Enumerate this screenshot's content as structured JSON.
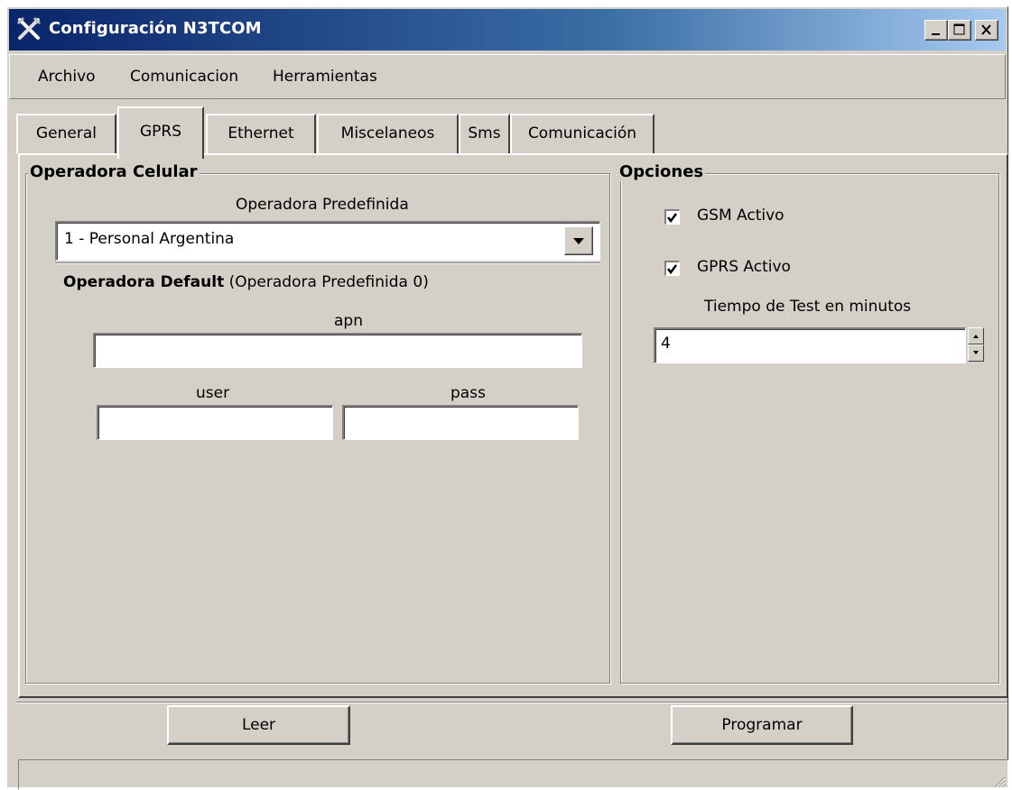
{
  "window": {
    "title": "Configuración N3TCOM",
    "icon": "tools-icon",
    "controls": [
      "minimize-icon",
      "maximize-icon",
      "close-icon"
    ]
  },
  "menu": {
    "items": [
      "Archivo",
      "Comunicacion",
      "Herramientas"
    ]
  },
  "tabs": [
    "General",
    "GPRS",
    "Ethernet",
    "Miscelaneos",
    "Sms",
    "Comunicación"
  ],
  "active_tab": "GPRS",
  "operadora": {
    "group_title": "Operadora Celular",
    "predefinida_label": "Operadora Predefinida",
    "predefinida_value": "1 - Personal Argentina",
    "default_title_bold": "Operadora Default",
    "default_title_rest": "(Operadora Predefinida 0)",
    "apn_label": "apn",
    "apn_value": "",
    "user_label": "user",
    "user_value": "",
    "pass_label": "pass",
    "pass_value": ""
  },
  "opciones": {
    "group_title": "Opciones",
    "gsm_label": "GSM Activo",
    "gsm_checked": true,
    "gprs_label": "GPRS Activo",
    "gprs_checked": true,
    "test_label": "Tiempo de Test en minutos",
    "test_value": "4"
  },
  "buttons": {
    "leer": "Leer",
    "programar": "Programar"
  },
  "status": {
    "text": ""
  }
}
